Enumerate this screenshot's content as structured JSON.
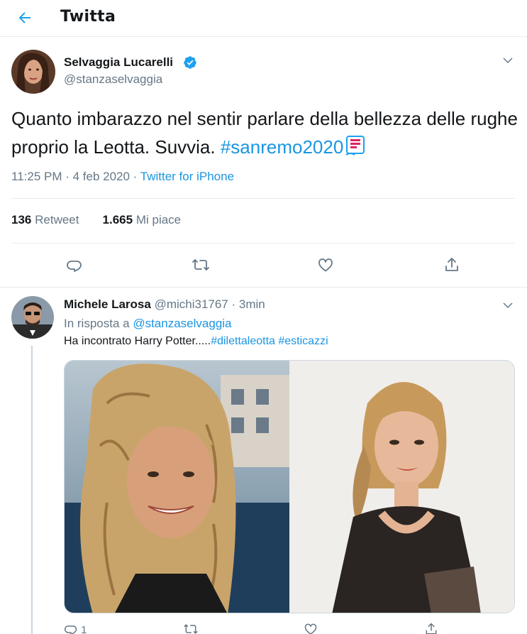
{
  "header": {
    "title": "Twitta",
    "back_icon": "arrow-left-icon",
    "accent": "#1da1f2"
  },
  "tweet": {
    "author": {
      "name": "Selvaggia Lucarelli",
      "handle": "@stanzaselvaggia",
      "verified": true
    },
    "text_main": "Quanto imbarazzo nel sentir parlare della bellezza delle rughe proprio la Leotta. Suvvia. ",
    "hashtag": "#sanremo2020",
    "emoji_icon": "sanremo-music-emoji",
    "time": "11:25 PM · 4 feb 2020 · ",
    "source": "Twitter for iPhone",
    "retweets_count": "136",
    "retweets_label": "Retweet",
    "likes_count": "1.665",
    "likes_label": "Mi piace"
  },
  "reply": {
    "author": {
      "name": "Michele Larosa",
      "handle": "@michi31767",
      "time": "· 3min"
    },
    "in_reply_prefix": "In risposta a ",
    "in_reply_handle": "@stanzaselvaggia",
    "text": "Ha incontrato Harry Potter.....",
    "hashtags": "#dilettaleotta #esticazzi",
    "reply_count": "1"
  },
  "colors": {
    "link": "#1b95e0",
    "secondary_text": "#657786",
    "divider": "#e6ecf0"
  }
}
